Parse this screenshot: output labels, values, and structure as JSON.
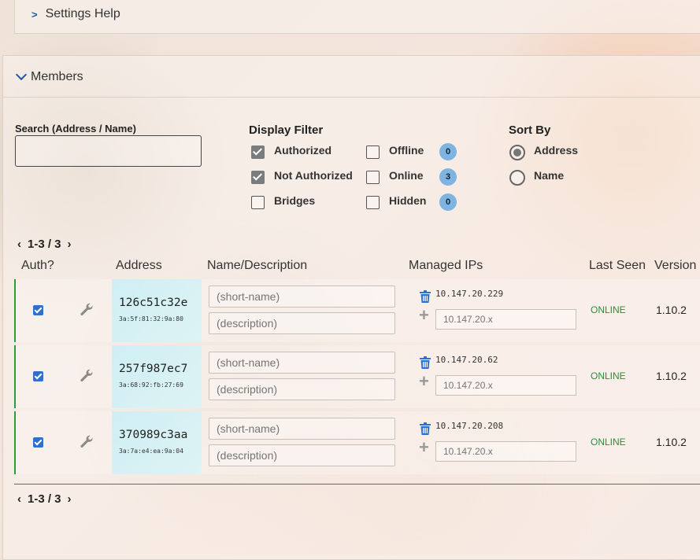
{
  "settings_help": {
    "label": "Settings Help"
  },
  "members": {
    "title": "Members",
    "search": {
      "label": "Search (Address / Name)",
      "value": "",
      "placeholder": ""
    },
    "display_filter": {
      "title": "Display Filter",
      "options": [
        {
          "label": "Authorized",
          "checked": true
        },
        {
          "label": "Not Authorized",
          "checked": true
        },
        {
          "label": "Bridges",
          "checked": false
        },
        {
          "label": "Offline",
          "checked": false,
          "count": "0"
        },
        {
          "label": "Online",
          "checked": false,
          "count": "3"
        },
        {
          "label": "Hidden",
          "checked": false,
          "count": "0"
        }
      ]
    },
    "sort_by": {
      "title": "Sort By",
      "options": [
        {
          "label": "Address",
          "selected": true
        },
        {
          "label": "Name",
          "selected": false
        }
      ]
    },
    "pager": {
      "label": "1-3 / 3"
    },
    "columns": [
      "Auth?",
      "Address",
      "Name/Description",
      "Managed IPs",
      "Last Seen",
      "Version"
    ],
    "rows": [
      {
        "authorized": true,
        "address": "126c51c32e",
        "mac": "3a:5f:81:32:9a:80",
        "short_name_placeholder": "(short-name)",
        "description_placeholder": "(description)",
        "ip": "10.147.20.229",
        "ip_placeholder": "10.147.20.x",
        "last_seen": "ONLINE",
        "version": "1.10.2"
      },
      {
        "authorized": true,
        "address": "257f987ec7",
        "mac": "3a:68:92:fb:27:69",
        "short_name_placeholder": "(short-name)",
        "description_placeholder": "(description)",
        "ip": "10.147.20.62",
        "ip_placeholder": "10.147.20.x",
        "last_seen": "ONLINE",
        "version": "1.10.2"
      },
      {
        "authorized": true,
        "address": "370989c3aa",
        "mac": "3a:7a:e4:ea:9a:04",
        "short_name_placeholder": "(short-name)",
        "description_placeholder": "(description)",
        "ip": "10.147.20.208",
        "ip_placeholder": "10.147.20.x",
        "last_seen": "ONLINE",
        "version": "1.10.2"
      }
    ]
  },
  "colors": {
    "accent": "#1d5aa6",
    "online": "#2e8b3a",
    "row_border": "#2e9a3a",
    "badge": "#7fb3e0"
  }
}
